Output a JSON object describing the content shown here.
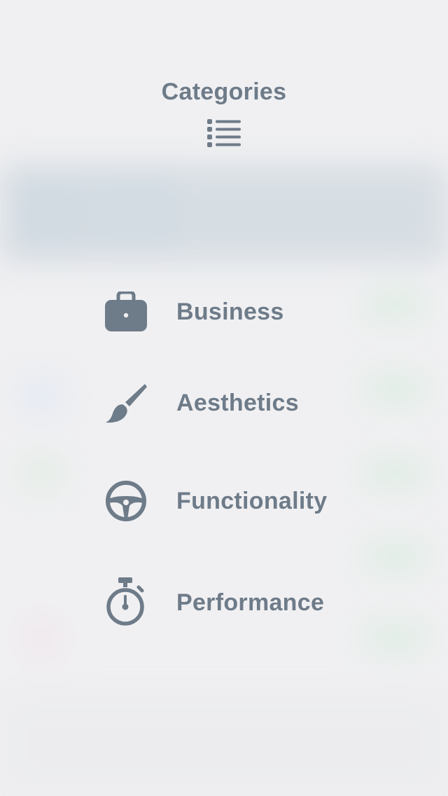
{
  "menu": {
    "title": "Categories",
    "title_icon": "list-icon",
    "items": [
      {
        "label": "Business",
        "icon": "briefcase-icon"
      },
      {
        "label": "Aesthetics",
        "icon": "paintbrush-icon"
      },
      {
        "label": "Functionality",
        "icon": "steering-wheel-icon"
      },
      {
        "label": "Performance",
        "icon": "stopwatch-icon"
      }
    ]
  },
  "colors": {
    "text": "#6e7b89",
    "background": "#efeff1",
    "blurred_accent_green": "#bfe6c9",
    "blurred_header_blue": "#b4c4cf"
  }
}
